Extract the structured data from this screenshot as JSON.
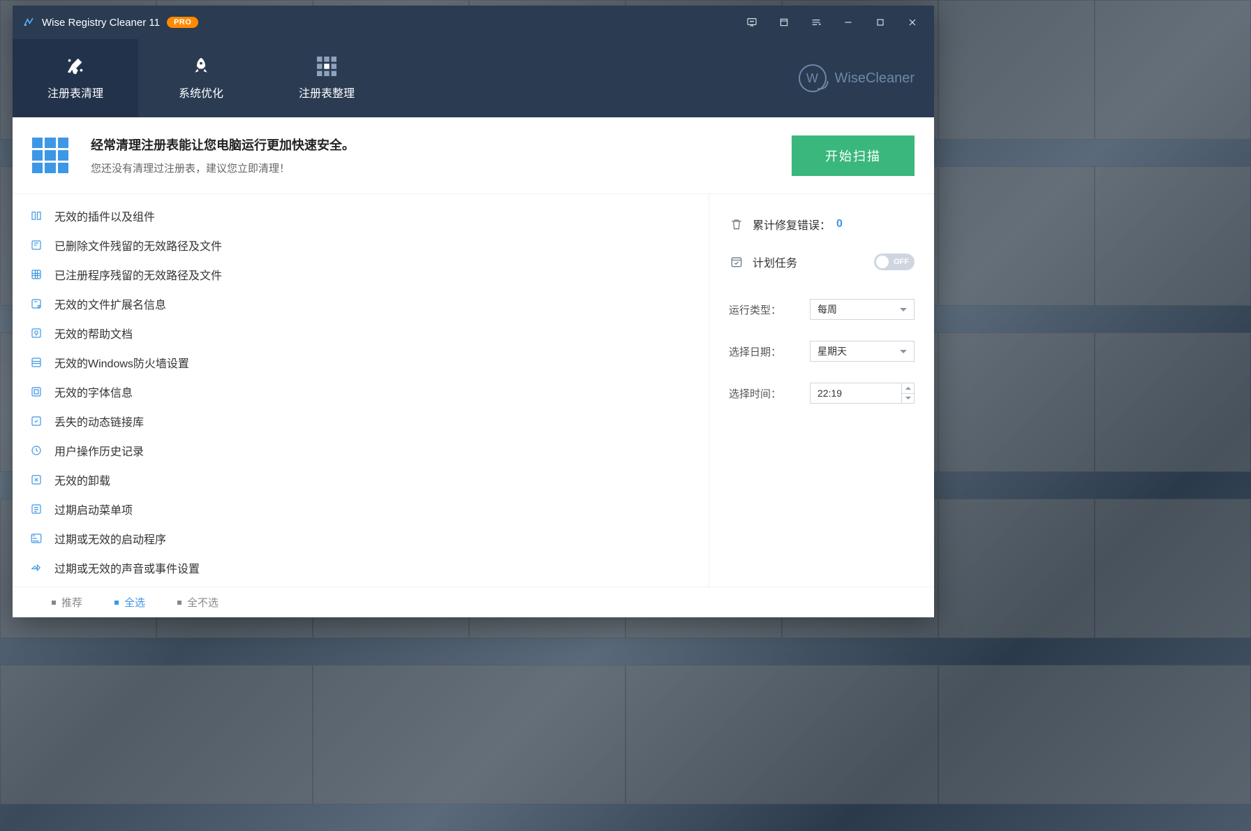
{
  "titlebar": {
    "title": "Wise Registry Cleaner 11",
    "pro_badge": "PRO"
  },
  "nav": {
    "tabs": [
      {
        "label": "注册表清理",
        "active": true
      },
      {
        "label": "系统优化",
        "active": false
      },
      {
        "label": "注册表整理",
        "active": false
      }
    ],
    "brand_letter": "W",
    "brand_text": "WiseCleaner"
  },
  "banner": {
    "headline": "经常清理注册表能让您电脑运行更加快速安全。",
    "subline": "您还没有清理过注册表，建议您立即清理！",
    "button": "开始扫描"
  },
  "registry_items": [
    "无效的插件以及组件",
    "已删除文件残留的无效路径及文件",
    "已注册程序残留的无效路径及文件",
    "无效的文件扩展名信息",
    "无效的帮助文档",
    "无效的Windows防火墙设置",
    "无效的字体信息",
    "丢失的动态链接库",
    "用户操作历史记录",
    "无效的卸载",
    "过期启动菜单项",
    "过期或无效的启动程序",
    "过期或无效的声音或事件设置"
  ],
  "sidebar": {
    "stat_label": "累计修复错误：",
    "stat_value": "0",
    "schedule_label": "计划任务",
    "toggle_text": "OFF",
    "fields": {
      "run_type": {
        "label": "运行类型：",
        "value": "每周"
      },
      "select_date": {
        "label": "选择日期：",
        "value": "星期天"
      },
      "select_time": {
        "label": "选择时间：",
        "value": "22:19"
      }
    }
  },
  "footer": {
    "links": [
      "推荐",
      "全选",
      "全不选"
    ]
  }
}
